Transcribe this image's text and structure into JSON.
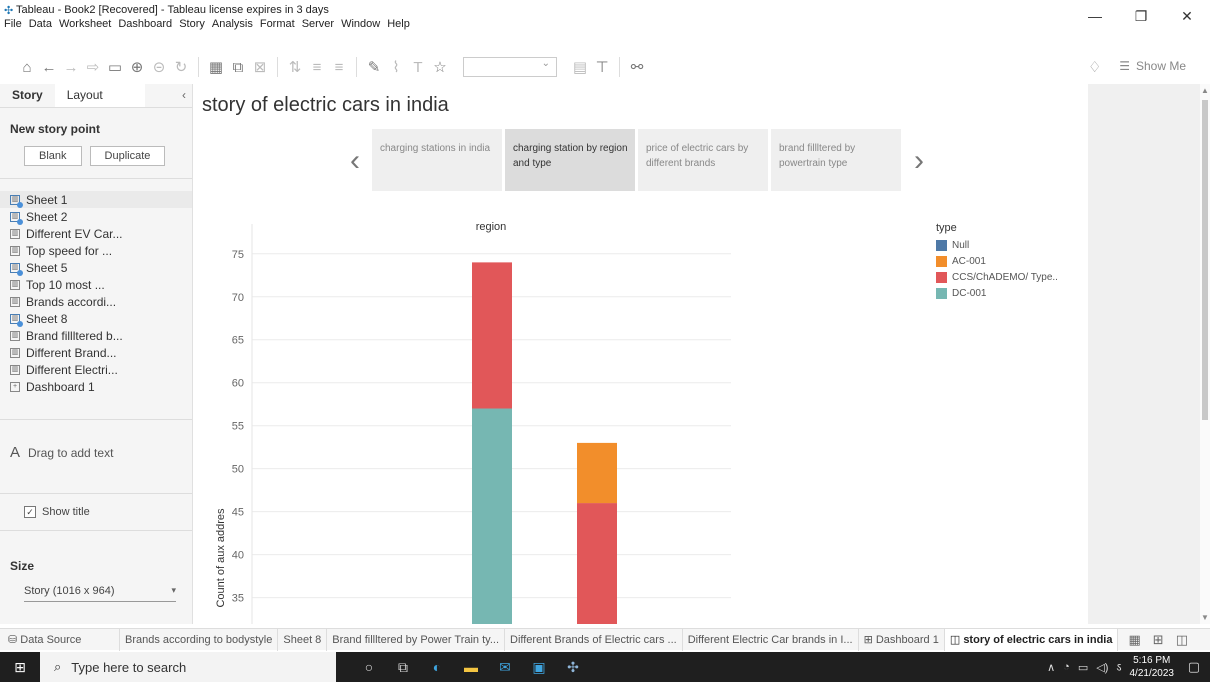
{
  "window": {
    "title": "Tableau - Book2 [Recovered] - Tableau license expires in 3 days",
    "menu": [
      "File",
      "Data",
      "Worksheet",
      "Dashboard",
      "Story",
      "Analysis",
      "Format",
      "Server",
      "Window",
      "Help"
    ],
    "controls": [
      "—",
      "❐",
      "✕"
    ]
  },
  "toolbar": {
    "show_me": "Show Me"
  },
  "leftpanel": {
    "tabs": [
      "Story",
      "Layout"
    ],
    "new_story_point": "New story point",
    "blank": "Blank",
    "duplicate": "Duplicate",
    "sheets": [
      {
        "label": "Sheet 1",
        "icon": "worksheet-check-icon"
      },
      {
        "label": "Sheet 2",
        "icon": "worksheet-check-icon"
      },
      {
        "label": "Different EV Car...",
        "icon": "worksheet-icon"
      },
      {
        "label": "Top speed for ...",
        "icon": "worksheet-icon"
      },
      {
        "label": "Sheet 5",
        "icon": "worksheet-check-icon"
      },
      {
        "label": "Top 10 most ...",
        "icon": "worksheet-icon"
      },
      {
        "label": "Brands accordi...",
        "icon": "worksheet-icon"
      },
      {
        "label": "Sheet 8",
        "icon": "worksheet-check-icon"
      },
      {
        "label": "Brand fillltered b...",
        "icon": "worksheet-icon"
      },
      {
        "label": "Different Brand...",
        "icon": "worksheet-icon"
      },
      {
        "label": "Different Electri...",
        "icon": "worksheet-icon"
      },
      {
        "label": "Dashboard 1",
        "icon": "dashboard-icon"
      }
    ],
    "drag_text": "Drag to add text",
    "show_title": "Show title",
    "size_label": "Size",
    "size_value": "Story (1016 x 964)"
  },
  "story": {
    "title": "story of electric cars in india",
    "points": [
      "charging stations in india",
      "charging station by region and type",
      "price of electric cars by different brands",
      "brand fillltered by powertrain type"
    ],
    "active_point": 1
  },
  "chart_data": {
    "type": "bar",
    "stacked": true,
    "title": "region",
    "ylabel": "Count of aux addres",
    "ylim": [
      31,
      78
    ],
    "yticks": [
      35,
      40,
      45,
      50,
      55,
      60,
      65,
      70,
      75
    ],
    "series": [
      {
        "name": "DC-001",
        "color": "#76b7b2",
        "values": [
          57,
          0
        ]
      },
      {
        "name": "CCS/ChADEMO/ Type..",
        "color": "#e15759",
        "values": [
          17,
          46
        ]
      },
      {
        "name": "AC-001",
        "color": "#f28e2b",
        "values": [
          0,
          7
        ]
      },
      {
        "name": "Null",
        "color": "#4e79a7",
        "values": [
          0,
          0
        ]
      }
    ],
    "legend": {
      "title": "type",
      "placement": "right",
      "order": [
        "Null",
        "AC-001",
        "CCS/ChADEMO/ Type..",
        "DC-001"
      ]
    }
  },
  "bottomtabs": [
    "Data Source",
    "Brands according to bodystyle",
    "Sheet 8",
    "Brand fillltered by Power Train ty...",
    "Different Brands of Electric cars ...",
    "Different Electric Car brands in I...",
    "Dashboard 1",
    "story of electric cars in india"
  ],
  "taskbar": {
    "search_placeholder": "Type here to search",
    "time": "5:16 PM",
    "date": "4/21/2023",
    "lang": "ऽ"
  }
}
